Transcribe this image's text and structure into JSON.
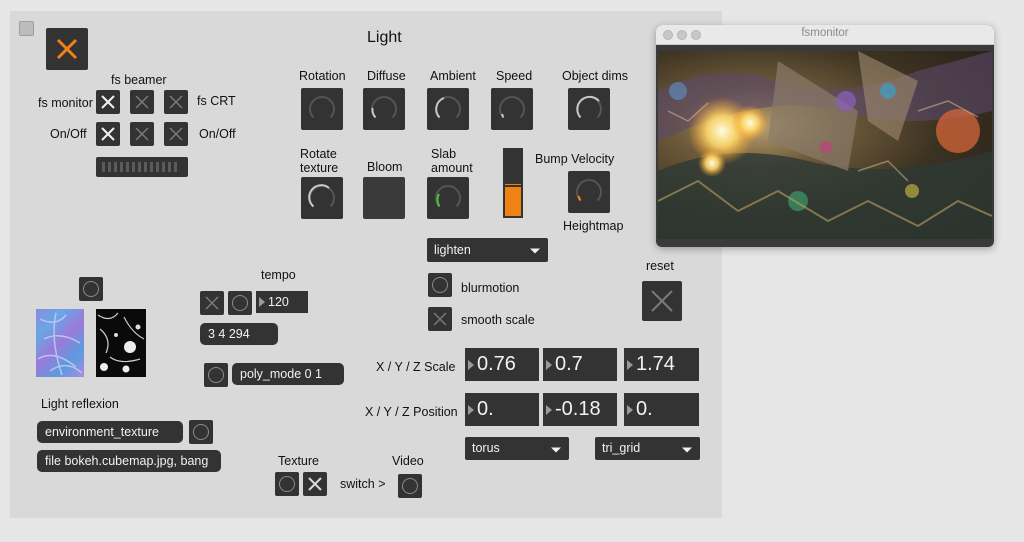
{
  "patcher": {
    "title": "Light",
    "fs_beamer": "fs beamer",
    "fs_monitor": "fs monitor",
    "fs_crt": "fs CRT",
    "on_off_left": "On/Off",
    "on_off_right": "On/Off",
    "dials": {
      "rotation": "Rotation",
      "diffuse": "Diffuse",
      "ambient": "Ambient",
      "speed": "Speed",
      "object_dims": "Object dims",
      "rotate_texture_1": "Rotate",
      "rotate_texture_2": "texture",
      "bloom": "Bloom",
      "slab_amount_1": "Slab",
      "slab_amount_2": "amount",
      "bump_velocity": "Bump Velocity",
      "heightmap": "Heightmap"
    },
    "dial_colors": {
      "default": "#c8c8c8",
      "slab": "#46c832",
      "bump": "#f08214"
    },
    "slider_color": "#f08214",
    "blend_menu": "lighten",
    "blurmotion": "blurmotion",
    "smooth_scale": "smooth scale",
    "reset": "reset",
    "tempo": "tempo",
    "tempo_value": "120",
    "time_sig": "3 4 294",
    "poly_mode": "poly_mode 0 1",
    "light_reflexion": "Light reflexion",
    "env_texture": "environment_texture",
    "file_msg": "file bokeh.cubemap.jpg, bang",
    "scale_label": "X / Y / Z Scale",
    "scale": [
      "0.76",
      "0.7",
      "1.74"
    ],
    "position_label": "X / Y / Z Position",
    "position": [
      "0.",
      "-0.18",
      "0."
    ],
    "shape_menu": "torus",
    "grid_menu": "tri_grid",
    "texture": "Texture",
    "video": "Video",
    "switch": "switch >"
  },
  "monitor": {
    "title": "fsmonitor"
  }
}
